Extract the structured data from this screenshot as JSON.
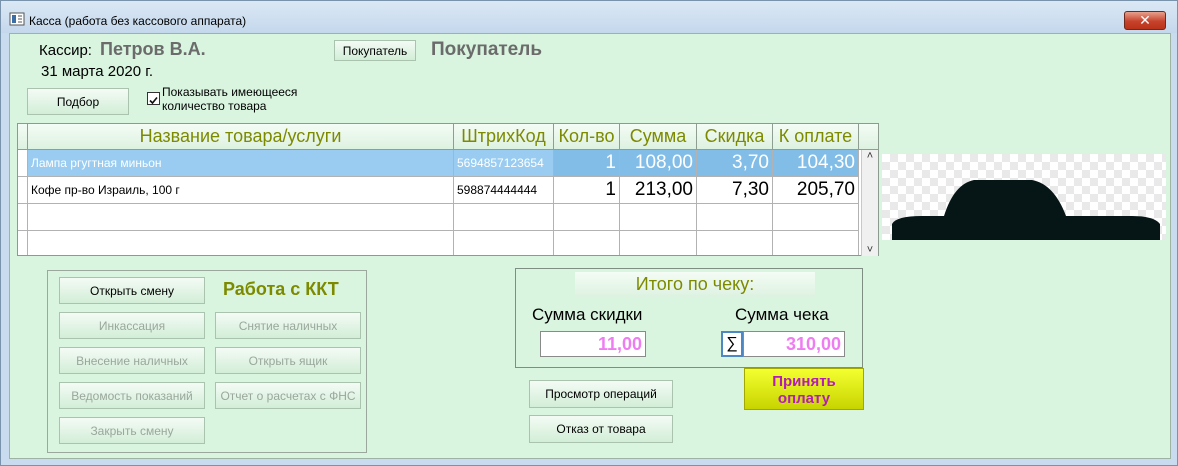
{
  "window": {
    "title": "Касса (работа без кассового аппарата)",
    "close_glyph": "✕"
  },
  "header": {
    "cashier_label": "Кассир:",
    "cashier_name": "Петров В.А.",
    "date": "31 марта 2020 г.",
    "buyer_button": "Покупатель",
    "buyer_name": "Покупатель",
    "pick_button": "Подбор",
    "show_stock_label_line1": "Показывать имеющееся",
    "show_stock_label_line2": "количество товара",
    "show_stock_checked": true
  },
  "table": {
    "columns": [
      "Название товара/услуги",
      "ШтрихКод",
      "Кол-во",
      "Сумма",
      "Скидка",
      "К оплате"
    ],
    "rows": [
      {
        "name": "Лампа ргугтная миньон",
        "barcode": "5694857123654",
        "qty": "1",
        "sum": "108,00",
        "discount": "3,70",
        "to_pay": "104,30",
        "selected": true
      },
      {
        "name": "Кофе пр-во Израиль, 100 г",
        "barcode": "598874444444",
        "qty": "1",
        "sum": "213,00",
        "discount": "7,30",
        "to_pay": "205,70",
        "selected": false
      }
    ],
    "scroll_up": "˄",
    "scroll_down": "˅"
  },
  "kkt": {
    "title": "Работа с ККТ",
    "open_shift": "Открыть смену",
    "encashment": "Инкассация",
    "withdraw_cash": "Снятие наличных",
    "deposit_cash": "Внесение наличных",
    "open_drawer": "Открыть ящик",
    "readings_report": "Ведомость показаний",
    "fns_report": "Отчет о расчетах с ФНС",
    "close_shift": "Закрыть смену"
  },
  "totals": {
    "title": "Итого по чеку:",
    "discount_label": "Сумма скидки",
    "discount_value": "11,00",
    "check_label": "Сумма чека",
    "check_value": "310,00",
    "sigma": "∑"
  },
  "actions": {
    "view_operations": "Просмотр операций",
    "refuse_item": "Отказ от товара",
    "accept_payment_line1": "Принять",
    "accept_payment_line2": "оплату"
  },
  "colors": {
    "client_bg": "#d9f5df",
    "olive_text": "#7d8a00",
    "pink_value": "#ef7df2",
    "pay_button": "#e6f000"
  }
}
